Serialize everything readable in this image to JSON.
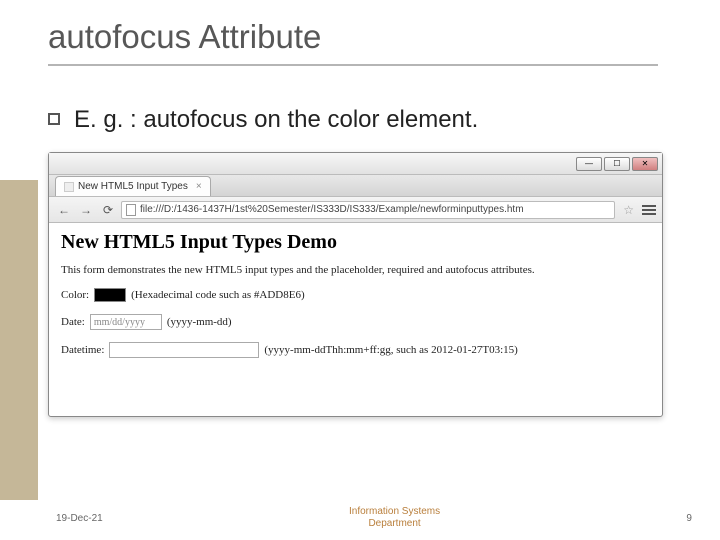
{
  "slide": {
    "title": "autofocus Attribute",
    "bullet": "E. g. : autofocus on the color element."
  },
  "browser": {
    "tab_title": "New HTML5 Input Types",
    "url": "file:///D:/1436-1437H/1st%20Semester/IS333D/IS333/Example/newforminputtypes.htm",
    "win_min": "—",
    "win_max": "☐",
    "win_close": "✕",
    "nav_back": "←",
    "nav_fwd": "→",
    "nav_reload": "⟳",
    "tab_close": "×",
    "star": "☆"
  },
  "page": {
    "heading": "New HTML5 Input Types Demo",
    "intro": "This form demonstrates the new HTML5 input types and the placeholder, required and autofocus attributes.",
    "color_label": "Color:",
    "color_hint": "(Hexadecimal code such as #ADD8E6)",
    "date_label": "Date:",
    "date_placeholder": "mm/dd/yyyy",
    "date_hint": "(yyyy-mm-dd)",
    "datetime_label": "Datetime:",
    "datetime_hint": "(yyyy-mm-ddThh:mm+ff:gg, such as 2012-01-27T03:15)"
  },
  "footer": {
    "date": "19-Dec-21",
    "center_line1": "Information Systems",
    "center_line2": "Department",
    "page_num": "9"
  }
}
